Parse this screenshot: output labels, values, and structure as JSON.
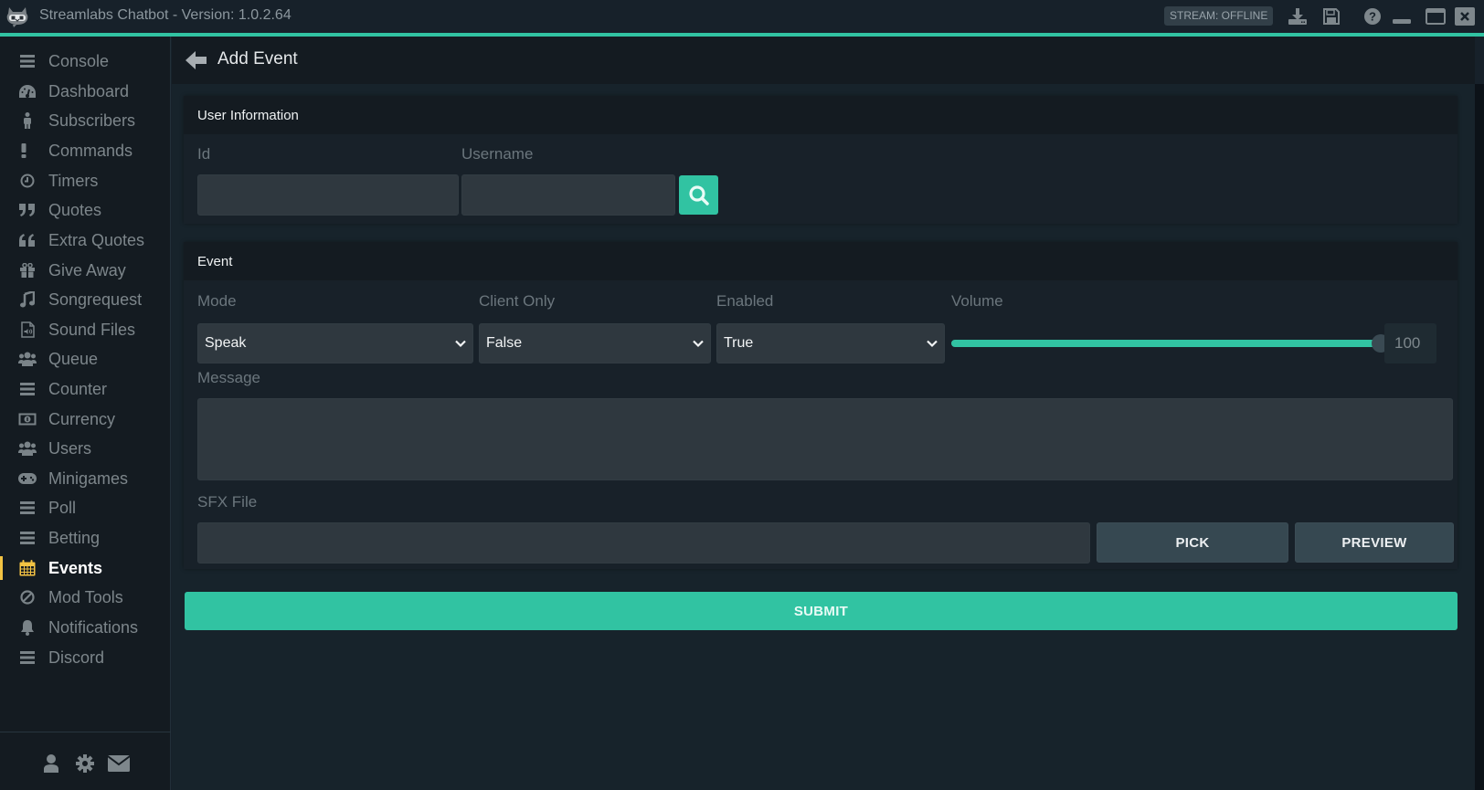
{
  "titlebar": {
    "app_title": "Streamlabs Chatbot",
    "version_text": " - Version: 1.0.2.64",
    "stream_status": "STREAM: OFFLINE",
    "icons": [
      "download-icon",
      "save-icon",
      "help-icon",
      "minimize-icon",
      "maximize-icon",
      "close-icon"
    ]
  },
  "colors": {
    "accent": "#31c3a2",
    "active_nav": "#f3c343",
    "background": "#17232b",
    "sidebar": "#141b21"
  },
  "sidebar": {
    "items": [
      {
        "label": "Console",
        "icon": "list-icon"
      },
      {
        "label": "Dashboard",
        "icon": "dashboard-icon"
      },
      {
        "label": "Subscribers",
        "icon": "person-icon"
      },
      {
        "label": "Commands",
        "icon": "exclamation-icon"
      },
      {
        "label": "Timers",
        "icon": "clock-icon"
      },
      {
        "label": "Quotes",
        "icon": "quote-right-icon"
      },
      {
        "label": "Extra Quotes",
        "icon": "quote-left-icon"
      },
      {
        "label": "Give Away",
        "icon": "gift-icon"
      },
      {
        "label": "Songrequest",
        "icon": "music-icon"
      },
      {
        "label": "Sound Files",
        "icon": "audio-file-icon"
      },
      {
        "label": "Queue",
        "icon": "users-icon"
      },
      {
        "label": "Counter",
        "icon": "list-icon"
      },
      {
        "label": "Currency",
        "icon": "money-icon"
      },
      {
        "label": "Users",
        "icon": "users-icon"
      },
      {
        "label": "Minigames",
        "icon": "gamepad-icon"
      },
      {
        "label": "Poll",
        "icon": "list-icon"
      },
      {
        "label": "Betting",
        "icon": "list-icon"
      },
      {
        "label": "Events",
        "icon": "calendar-icon",
        "active": true
      },
      {
        "label": "Mod Tools",
        "icon": "ban-icon"
      },
      {
        "label": "Notifications",
        "icon": "bell-icon"
      },
      {
        "label": "Discord",
        "icon": "list-icon"
      }
    ],
    "footer_icons": [
      "user-icon",
      "gear-icon",
      "envelope-icon"
    ]
  },
  "page": {
    "title": "Add Event",
    "back_icon": "arrow-left-icon"
  },
  "user_info": {
    "heading": "User Information",
    "id_label": "Id",
    "id_value": "",
    "username_label": "Username",
    "username_value": "",
    "search_icon": "search-icon"
  },
  "event": {
    "heading": "Event",
    "mode_label": "Mode",
    "mode_value": "Speak",
    "client_only_label": "Client Only",
    "client_only_value": "False",
    "enabled_label": "Enabled",
    "enabled_value": "True",
    "volume_label": "Volume",
    "volume_value": "100",
    "volume_fraction": 1.0,
    "message_label": "Message",
    "message_value": "",
    "sfx_label": "SFX File",
    "sfx_value": "",
    "pick_label": "PICK",
    "preview_label": "PREVIEW"
  },
  "submit_label": "SUBMIT"
}
